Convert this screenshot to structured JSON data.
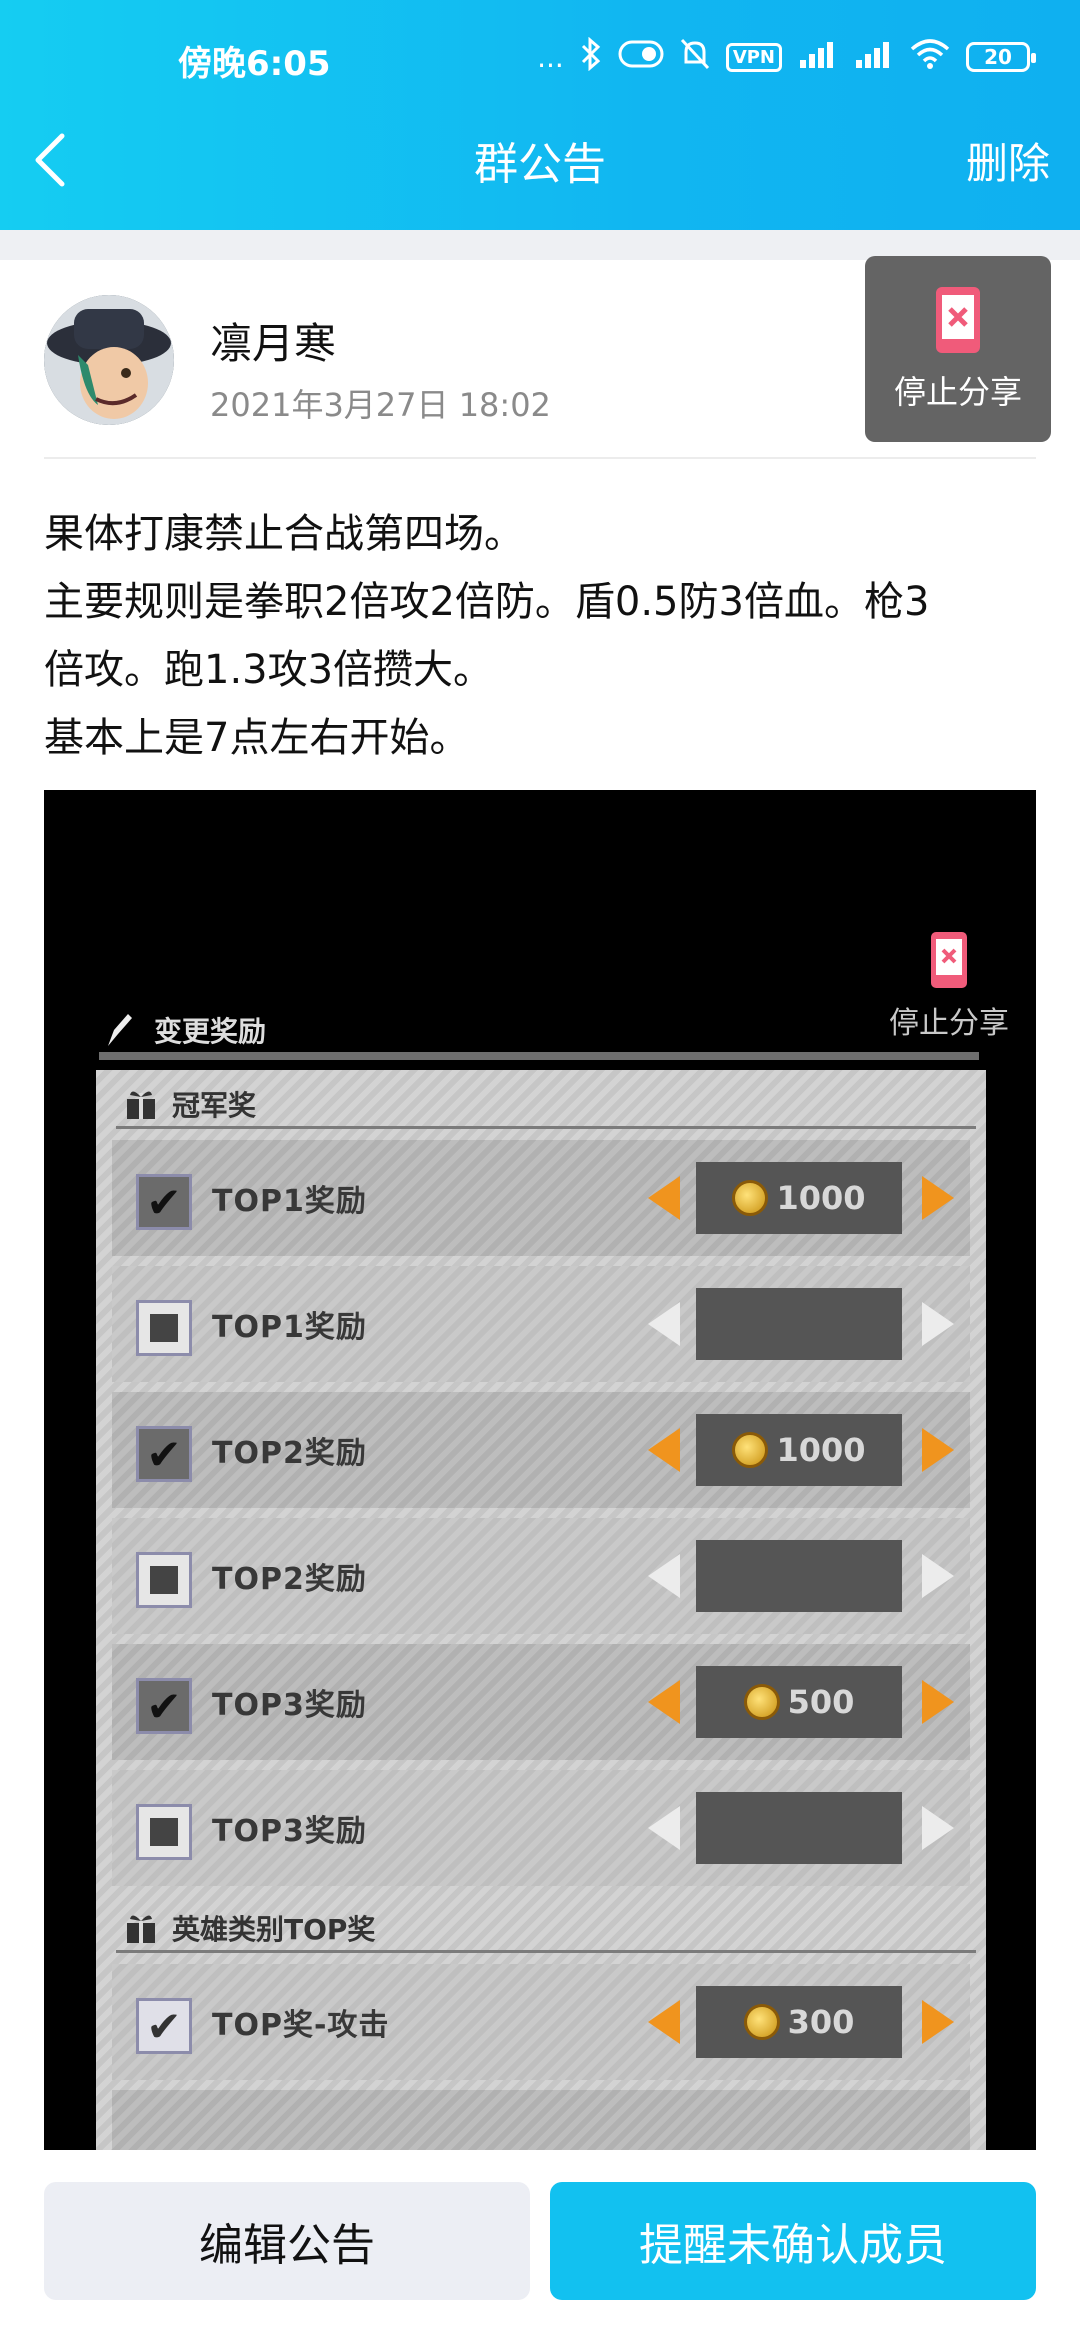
{
  "status_bar": {
    "time": "傍晚6:05",
    "dots": "...",
    "vpn": "VPN",
    "battery": "20"
  },
  "header": {
    "title": "群公告",
    "delete_label": "删除"
  },
  "author": {
    "name": "凛月寒",
    "time": "2021年3月27日 18:02"
  },
  "stop_share": {
    "label": "停止分享"
  },
  "body_lines": [
    "果体打康禁止合战第四场。",
    "主要规则是拳职2倍攻2倍防。盾0.5防3倍血。枪3",
    "倍攻。跑1.3攻3倍攒大。",
    "基本上是7点左右开始。"
  ],
  "embedded_screenshot": {
    "stop_share_label": "停止分享",
    "header_title": "变更奖励",
    "section1_title": "冠军奖",
    "section2_title": "英雄类别TOP奖",
    "rows": [
      {
        "label": "TOP1奖励",
        "checked": true,
        "value": "1000"
      },
      {
        "label": "TOP1奖励",
        "checked": false,
        "value": ""
      },
      {
        "label": "TOP2奖励",
        "checked": true,
        "value": "1000"
      },
      {
        "label": "TOP2奖励",
        "checked": false,
        "value": ""
      },
      {
        "label": "TOP3奖励",
        "checked": true,
        "value": "500"
      },
      {
        "label": "TOP3奖励",
        "checked": false,
        "value": ""
      },
      {
        "label": "TOP奖-攻击",
        "checked": true,
        "value": "300"
      }
    ]
  },
  "footer": {
    "edit_label": "编辑公告",
    "remind_label": "提醒未确认成员"
  }
}
